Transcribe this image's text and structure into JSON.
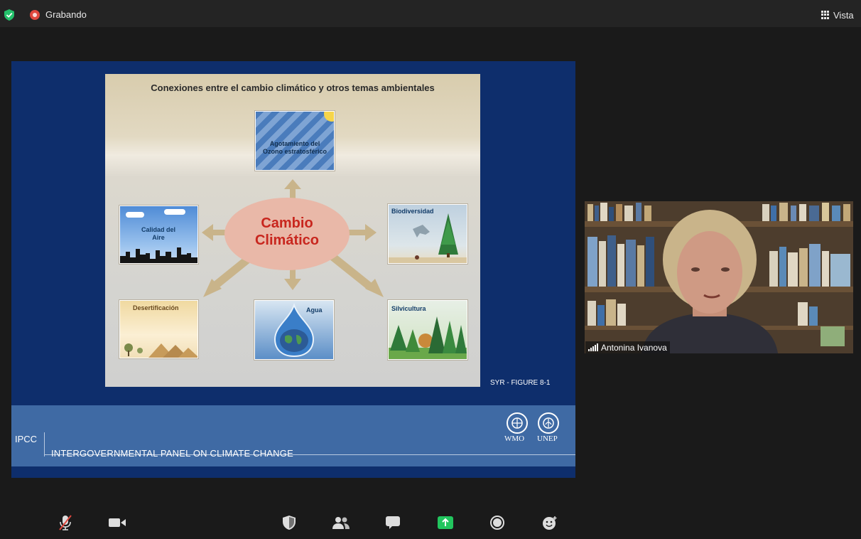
{
  "topbar": {
    "security_icon": "shield-check-icon",
    "recording_label": "Grabando",
    "view_label": "Vista"
  },
  "slide": {
    "title": "Conexiones entre el cambio climático y otros temas ambientales",
    "center_line1": "Cambio",
    "center_line2": "Climático",
    "tiles": {
      "ozone_line1": "Agotamiento del",
      "ozone_line2": "Ozono estratosférico",
      "air_line1": "Calidad del",
      "air_line2": "Aire",
      "biodiversity": "Biodiversidad",
      "desertification": "Desertificación",
      "water": "Agua",
      "forestry": "Silvicultura"
    },
    "footnote": "SYR - FIGURE 8-1",
    "org_abbr": "IPCC",
    "org_full": "INTERGOVERNMENTAL PANEL ON CLIMATE CHANGE",
    "logo_wmo": "WMO",
    "logo_unep": "UNEP"
  },
  "participant": {
    "name": "Antonina Ivanova"
  },
  "toolbar": {
    "mute_icon": "microphone-muted-icon",
    "video_icon": "video-camera-icon",
    "security_icon": "shield-icon",
    "participants_icon": "people-icon",
    "chat_icon": "chat-bubble-icon",
    "share_icon": "share-screen-icon",
    "record_icon": "record-icon",
    "reactions_icon": "smiley-icon"
  },
  "colors": {
    "share_accent": "#22c55e",
    "recording": "#e0483e",
    "center_text": "#c8261e"
  }
}
